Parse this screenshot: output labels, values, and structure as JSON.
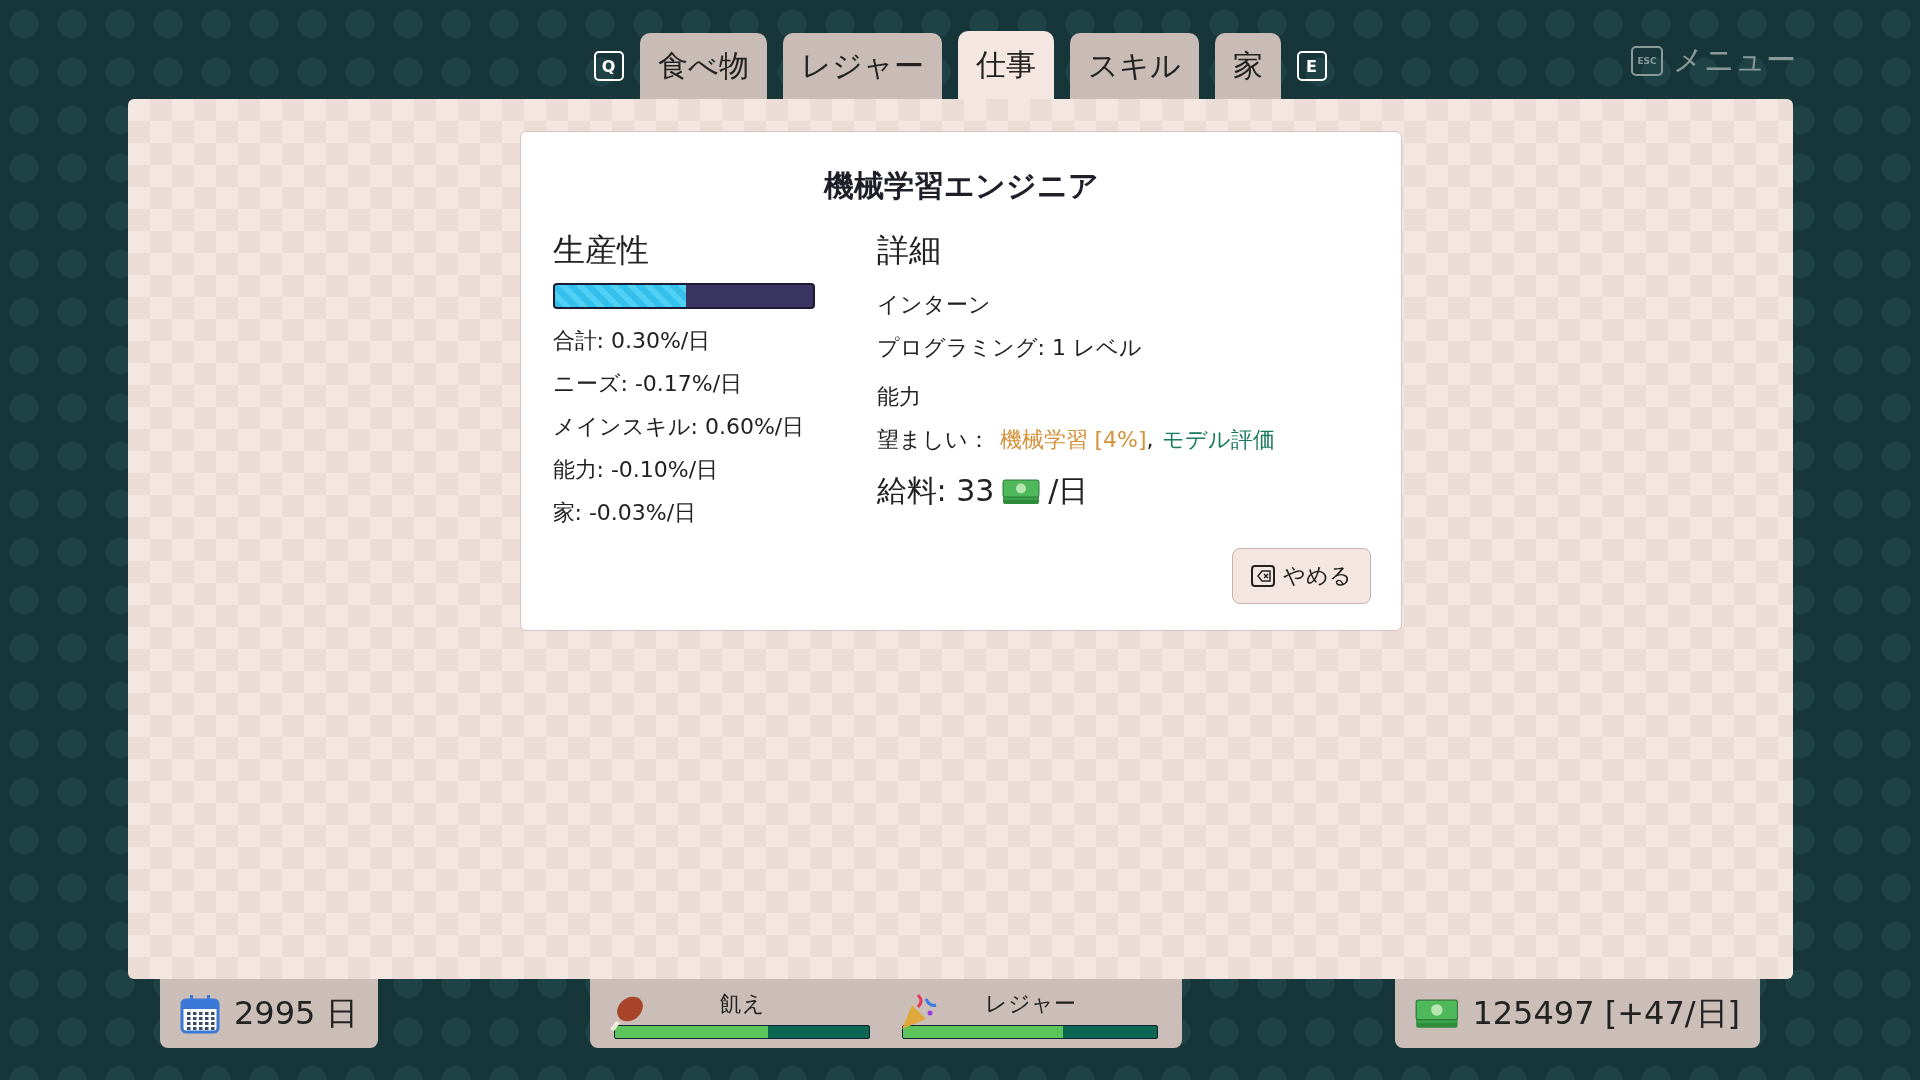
{
  "tabs": {
    "left_key": "Q",
    "right_key": "E",
    "items": [
      {
        "label": "食べ物",
        "selected": false
      },
      {
        "label": "レジャー",
        "selected": false
      },
      {
        "label": "仕事",
        "selected": true
      },
      {
        "label": "スキル",
        "selected": false
      },
      {
        "label": "家",
        "selected": false
      }
    ]
  },
  "menu": {
    "key": "ESC",
    "label": "メニュー"
  },
  "job": {
    "title": "機械学習エンジニア",
    "productivity": {
      "heading": "生産性",
      "level": 0.51,
      "lines": [
        "合計: 0.30%/日",
        "ニーズ: -0.17%/日",
        "メインスキル: 0.60%/日",
        "能力: -0.10%/日",
        "家: -0.03%/日"
      ]
    },
    "details": {
      "heading": "詳細",
      "rank": "インターン",
      "requirement": "プログラミング: 1 レベル",
      "abilities_heading": "能力",
      "desired_label": "望ましい：",
      "desired": [
        {
          "text": "機械学習 [4%]",
          "color": "#d4923a"
        },
        {
          "text": "モデル評価",
          "color": "#177a5c"
        }
      ],
      "separator": ",",
      "salary": "給料: 33",
      "salary_unit": "/日"
    },
    "quit_button": "やめる"
  },
  "status": {
    "days": "2995 日",
    "needs": [
      {
        "kind": "hunger",
        "label": "飢え",
        "level": 0.6
      },
      {
        "kind": "leisure",
        "label": "レジャー",
        "level": 0.63
      }
    ],
    "money": "125497 [+47/日]"
  }
}
